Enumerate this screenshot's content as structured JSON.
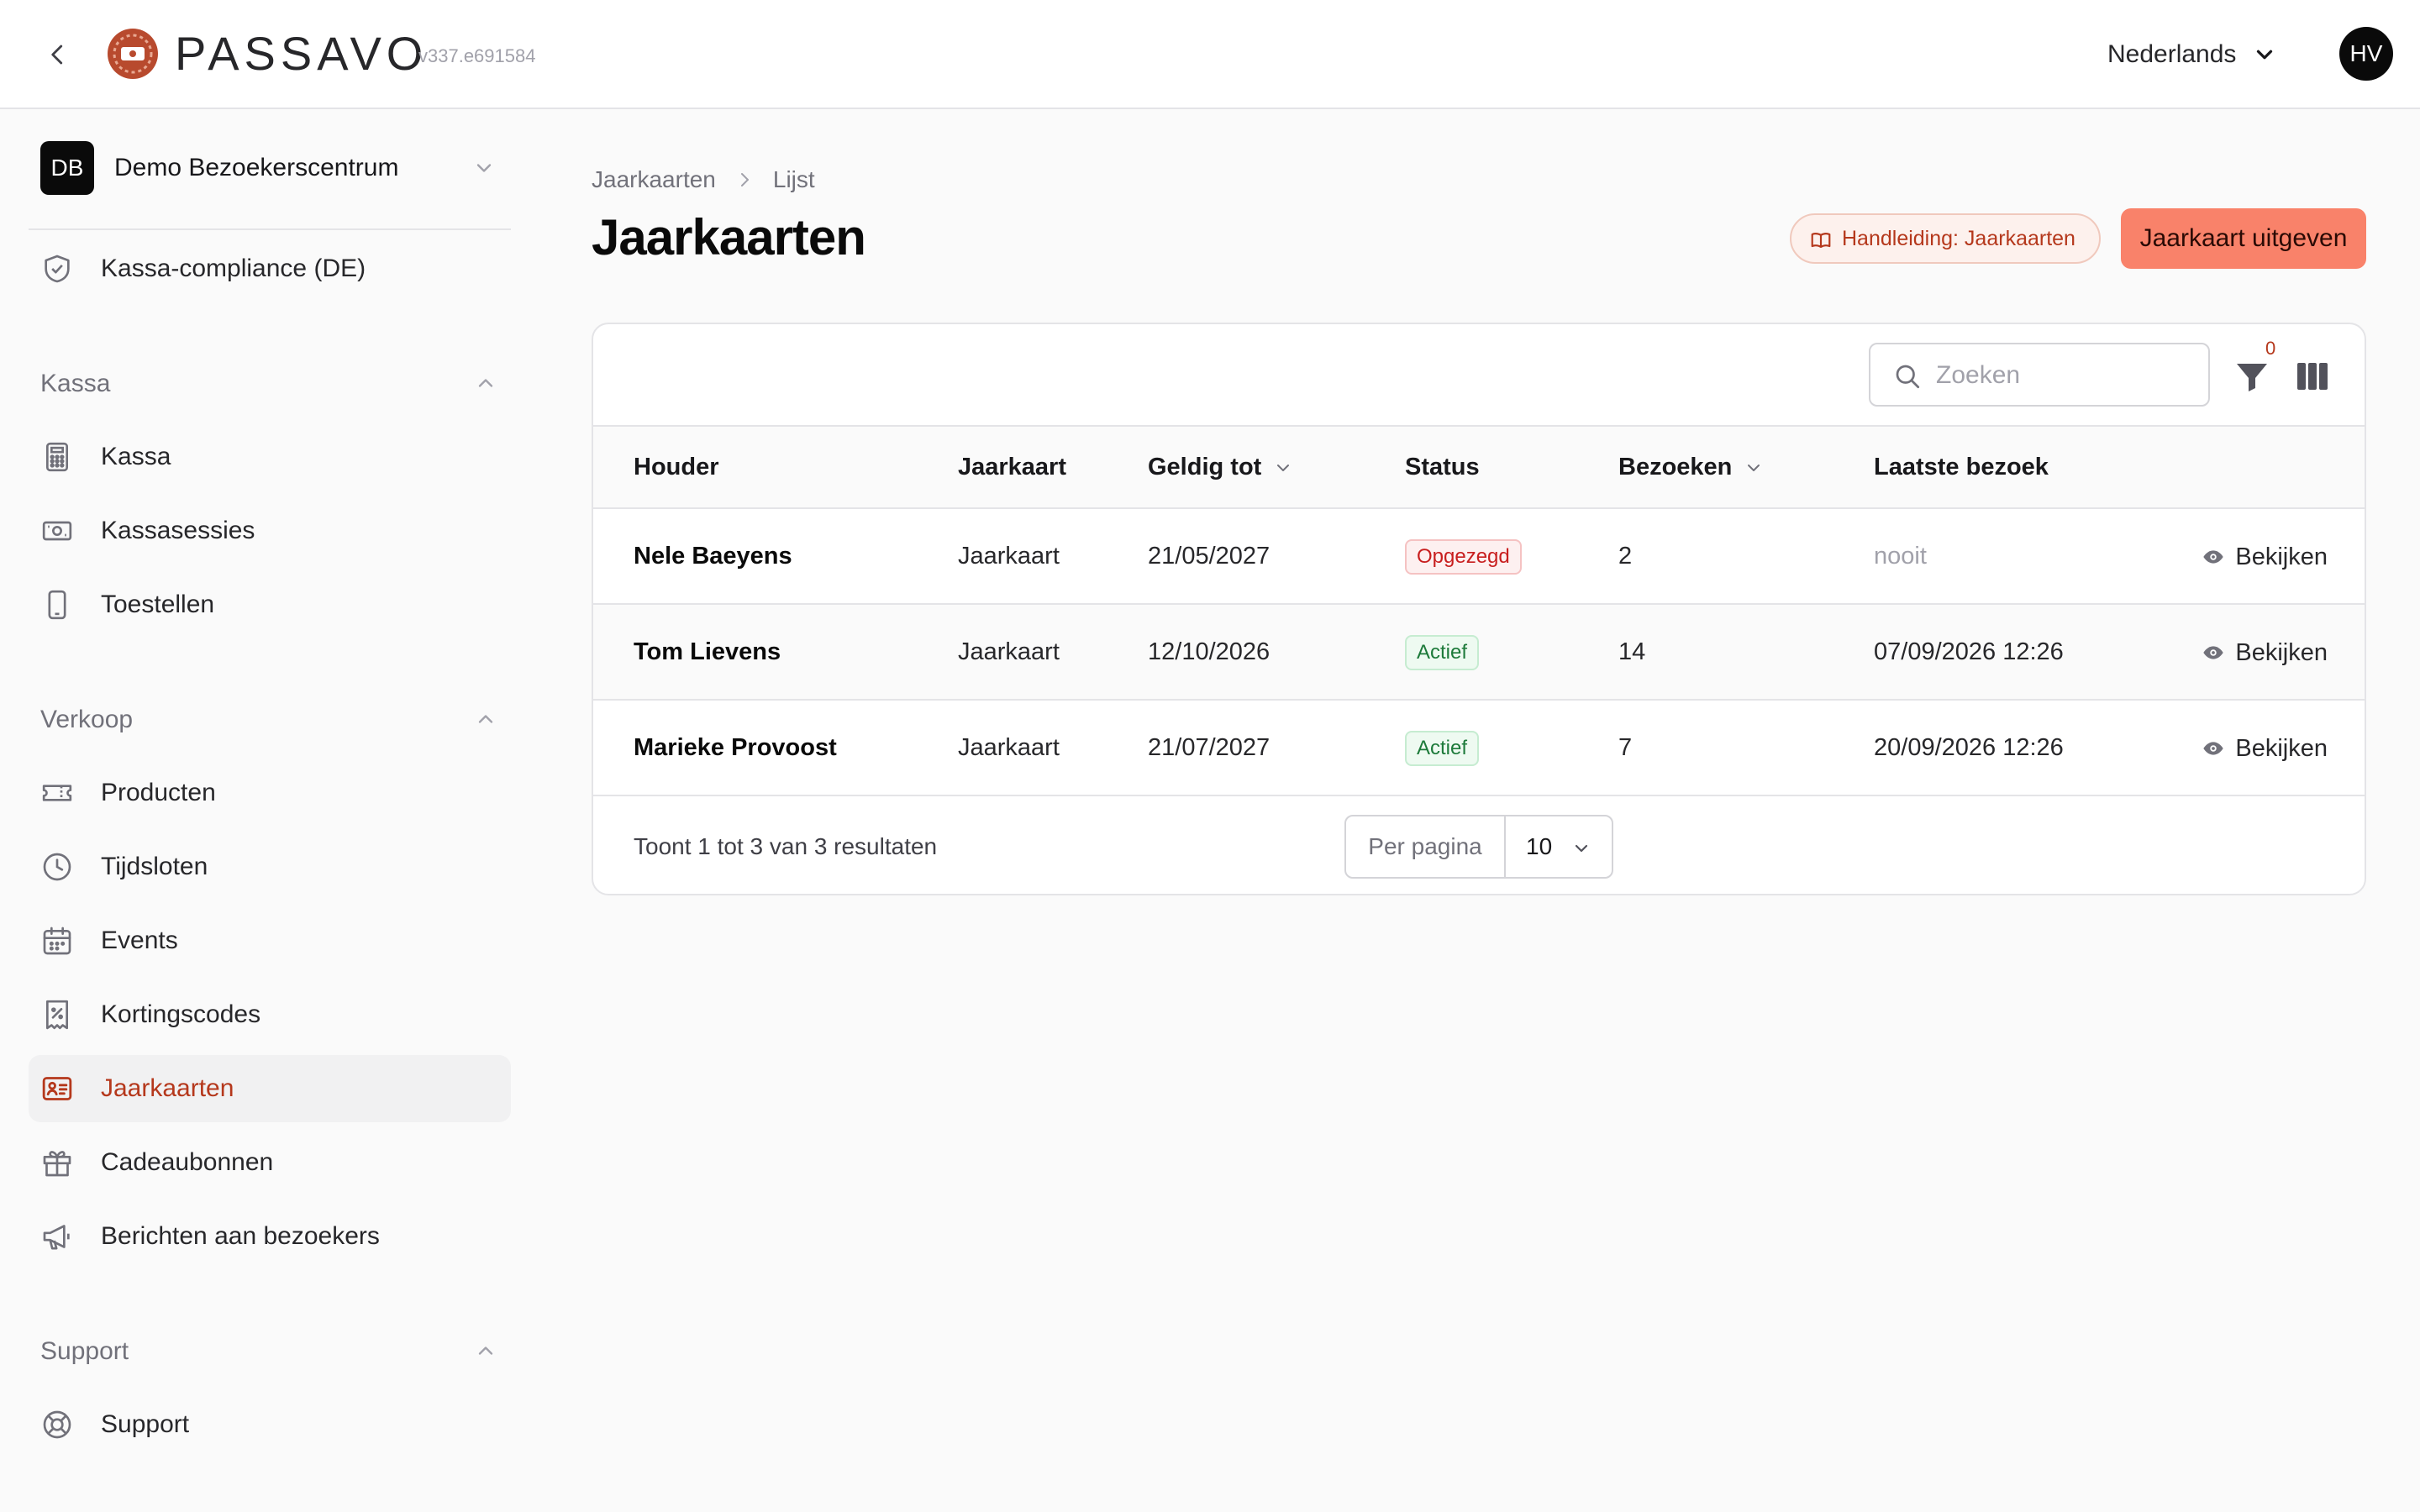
{
  "header": {
    "brand": "PASSAVO",
    "version": "v337.e691584",
    "language": "Nederlands",
    "user_initials": "HV"
  },
  "sidebar": {
    "org_badge": "DB",
    "org_name": "Demo Bezoekerscentrum",
    "top_items": [
      {
        "label": "Kassa-compliance (DE)",
        "icon": "shield-check-icon"
      }
    ],
    "sections": [
      {
        "title": "Kassa",
        "items": [
          {
            "label": "Kassa",
            "icon": "calculator-icon"
          },
          {
            "label": "Kassasessies",
            "icon": "cash-icon"
          },
          {
            "label": "Toestellen",
            "icon": "phone-icon"
          }
        ]
      },
      {
        "title": "Verkoop",
        "items": [
          {
            "label": "Producten",
            "icon": "ticket-icon"
          },
          {
            "label": "Tijdsloten",
            "icon": "clock-icon"
          },
          {
            "label": "Events",
            "icon": "calendar-icon"
          },
          {
            "label": "Kortingscodes",
            "icon": "receipt-percent-icon"
          },
          {
            "label": "Jaarkaarten",
            "icon": "id-card-icon",
            "active": true
          },
          {
            "label": "Cadeaubonnen",
            "icon": "gift-icon"
          },
          {
            "label": "Berichten aan bezoekers",
            "icon": "megaphone-icon"
          }
        ]
      },
      {
        "title": "Support",
        "items": [
          {
            "label": "Support",
            "icon": "lifebuoy-icon"
          }
        ]
      }
    ]
  },
  "main": {
    "breadcrumb": [
      "Jaarkaarten",
      "Lijst"
    ],
    "title": "Jaarkaarten",
    "guide_button": "Handleiding: Jaarkaarten",
    "primary_button": "Jaarkaart uitgeven",
    "search_placeholder": "Zoeken",
    "filter_count": "0",
    "columns": [
      "Houder",
      "Jaarkaart",
      "Geldig tot",
      "Status",
      "Bezoeken",
      "Laatste bezoek"
    ],
    "rows": [
      {
        "holder": "Nele Baeyens",
        "card": "Jaarkaart",
        "valid_until": "21/05/2027",
        "status": "Opgezegd",
        "visits": "2",
        "last_visit": "nooit",
        "action": "Bekijken"
      },
      {
        "holder": "Tom Lievens",
        "card": "Jaarkaart",
        "valid_until": "12/10/2026",
        "status": "Actief",
        "visits": "14",
        "last_visit": "07/09/2026 12:26",
        "action": "Bekijken"
      },
      {
        "holder": "Marieke Provoost",
        "card": "Jaarkaart",
        "valid_until": "21/07/2027",
        "status": "Actief",
        "visits": "7",
        "last_visit": "20/09/2026 12:26",
        "action": "Bekijken"
      }
    ],
    "results_text": "Toont 1 tot 3 van 3 resultaten",
    "per_page_label": "Per pagina",
    "per_page_value": "10"
  },
  "colors": {
    "accent": "#f9826a",
    "accent_text": "#b5381c",
    "status_cancelled": "#c81e1e",
    "status_active": "#1d7a3a"
  }
}
